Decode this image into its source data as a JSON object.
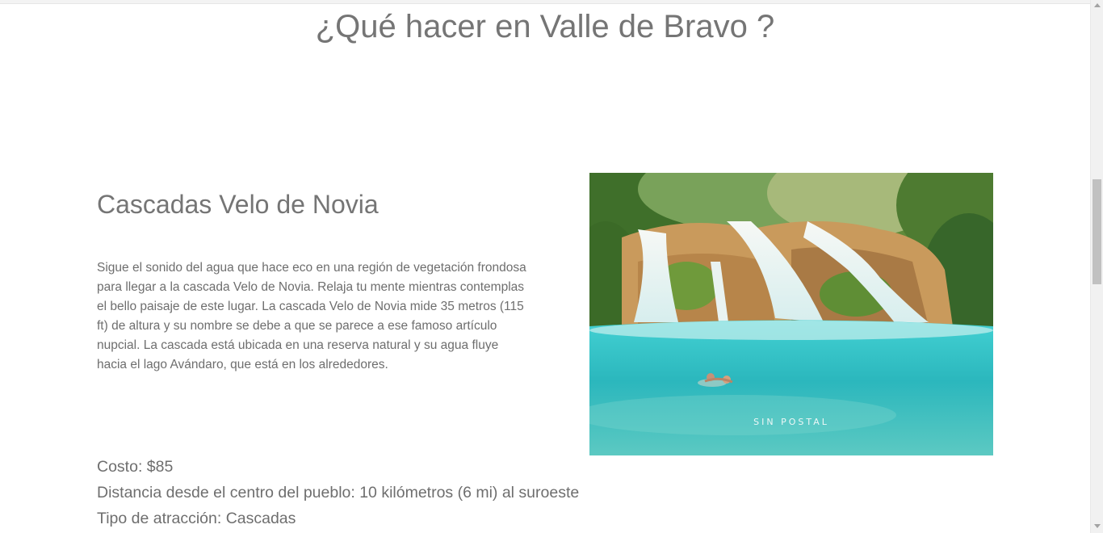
{
  "page": {
    "title": "¿Qué hacer en Valle de Bravo ?"
  },
  "attraction": {
    "name": "Cascadas Velo de Novia",
    "description": "Sigue el sonido del agua que hace eco en una región de vegetación frondosa para llegar a la cascada Velo de Novia. Relaja tu mente mientras contemplas el bello paisaje de este lugar. La cascada Velo de Novia mide 35 metros (115 ft) de altura y su nombre se debe a que se parece a ese famoso artículo nupcial. La cascada está ubicada en una reserva natural y su agua fluye hacia el lago Avándaro, que está en los alrededores.",
    "cost": "Costo: $85",
    "distance": "Distancia desde el centro del pueblo: 10 kilómetros (6 mi) al suroeste",
    "type": "Tipo de atracción: Cascadas",
    "image_watermark": "SIN POSTAL"
  },
  "colors": {
    "text": "#757575",
    "water": "#2fc3c4",
    "foliage": "#4f7a2c"
  },
  "icons": {
    "scroll_up": "scroll-up-arrow-icon",
    "scroll_down": "scroll-down-arrow-icon"
  }
}
